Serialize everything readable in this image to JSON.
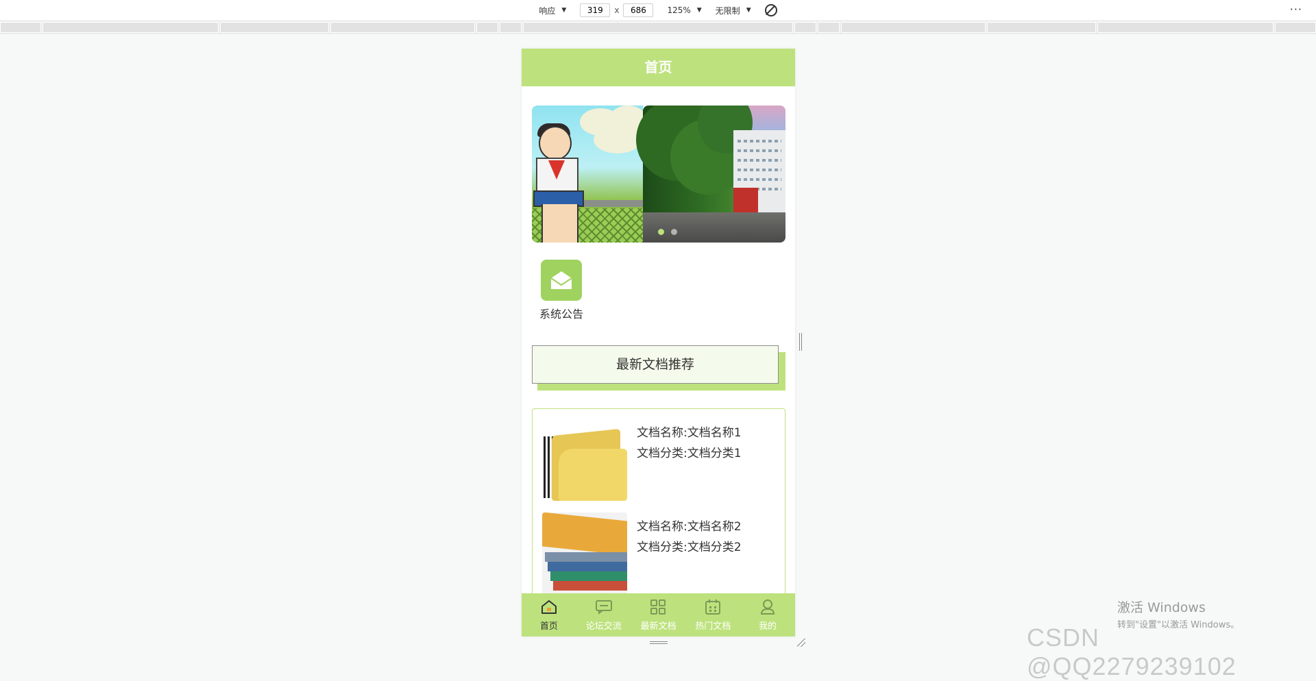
{
  "devtools": {
    "responsive_label": "响应",
    "width_value": "319",
    "times_label": "x",
    "height_value": "686",
    "zoom_label": "125%",
    "throttle_label": "无限制",
    "more_label": "···"
  },
  "app": {
    "header_title": "首页",
    "banner": {
      "slides": 2,
      "active_index": 0
    },
    "quick_entry": {
      "label": "系统公告",
      "icon": "envelope-icon"
    },
    "section_title": "最新文档推荐",
    "documents": [
      {
        "name": "文档名称:文档名称1",
        "category": "文档分类:文档分类1"
      },
      {
        "name": "文档名称:文档名称2",
        "category": "文档分类:文档分类2"
      }
    ],
    "tabs": [
      {
        "label": "首页",
        "icon": "home-icon",
        "active": true
      },
      {
        "label": "论坛交流",
        "icon": "chat-icon",
        "active": false
      },
      {
        "label": "最新文档",
        "icon": "grid-icon",
        "active": false
      },
      {
        "label": "热门文档",
        "icon": "calendar-icon",
        "active": false
      },
      {
        "label": "我的",
        "icon": "user-icon",
        "active": false
      }
    ]
  },
  "overlay": {
    "activation_title": "激活 Windows",
    "activation_sub": "转到\"设置\"以激活 Windows。",
    "csdn": "CSDN @QQ2279239102"
  },
  "colors": {
    "brand_green": "#bde27d",
    "icon_green": "#9fd25f"
  }
}
